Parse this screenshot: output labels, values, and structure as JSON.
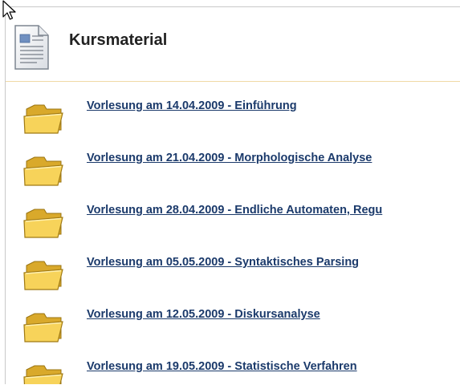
{
  "page": {
    "title": "Kursmaterial",
    "accent_colors": {
      "link": "#1b3a6b",
      "folder": "#f2c44a",
      "divider": "#f0d9a6"
    }
  },
  "icons": {
    "header": "document-icon",
    "items": "folder-icon",
    "pointer": "mouse-cursor-icon"
  },
  "items": [
    {
      "label": "Vorlesung am 14.04.2009 - Einführung"
    },
    {
      "label": "Vorlesung am 21.04.2009 - Morphologische Analyse"
    },
    {
      "label": "Vorlesung am 28.04.2009 - Endliche Automaten, Regu"
    },
    {
      "label": "Vorlesung am 05.05.2009 - Syntaktisches Parsing"
    },
    {
      "label": "Vorlesung am 12.05.2009 - Diskursanalyse"
    },
    {
      "label": "Vorlesung am 19.05.2009 - Statistische Verfahren"
    }
  ]
}
